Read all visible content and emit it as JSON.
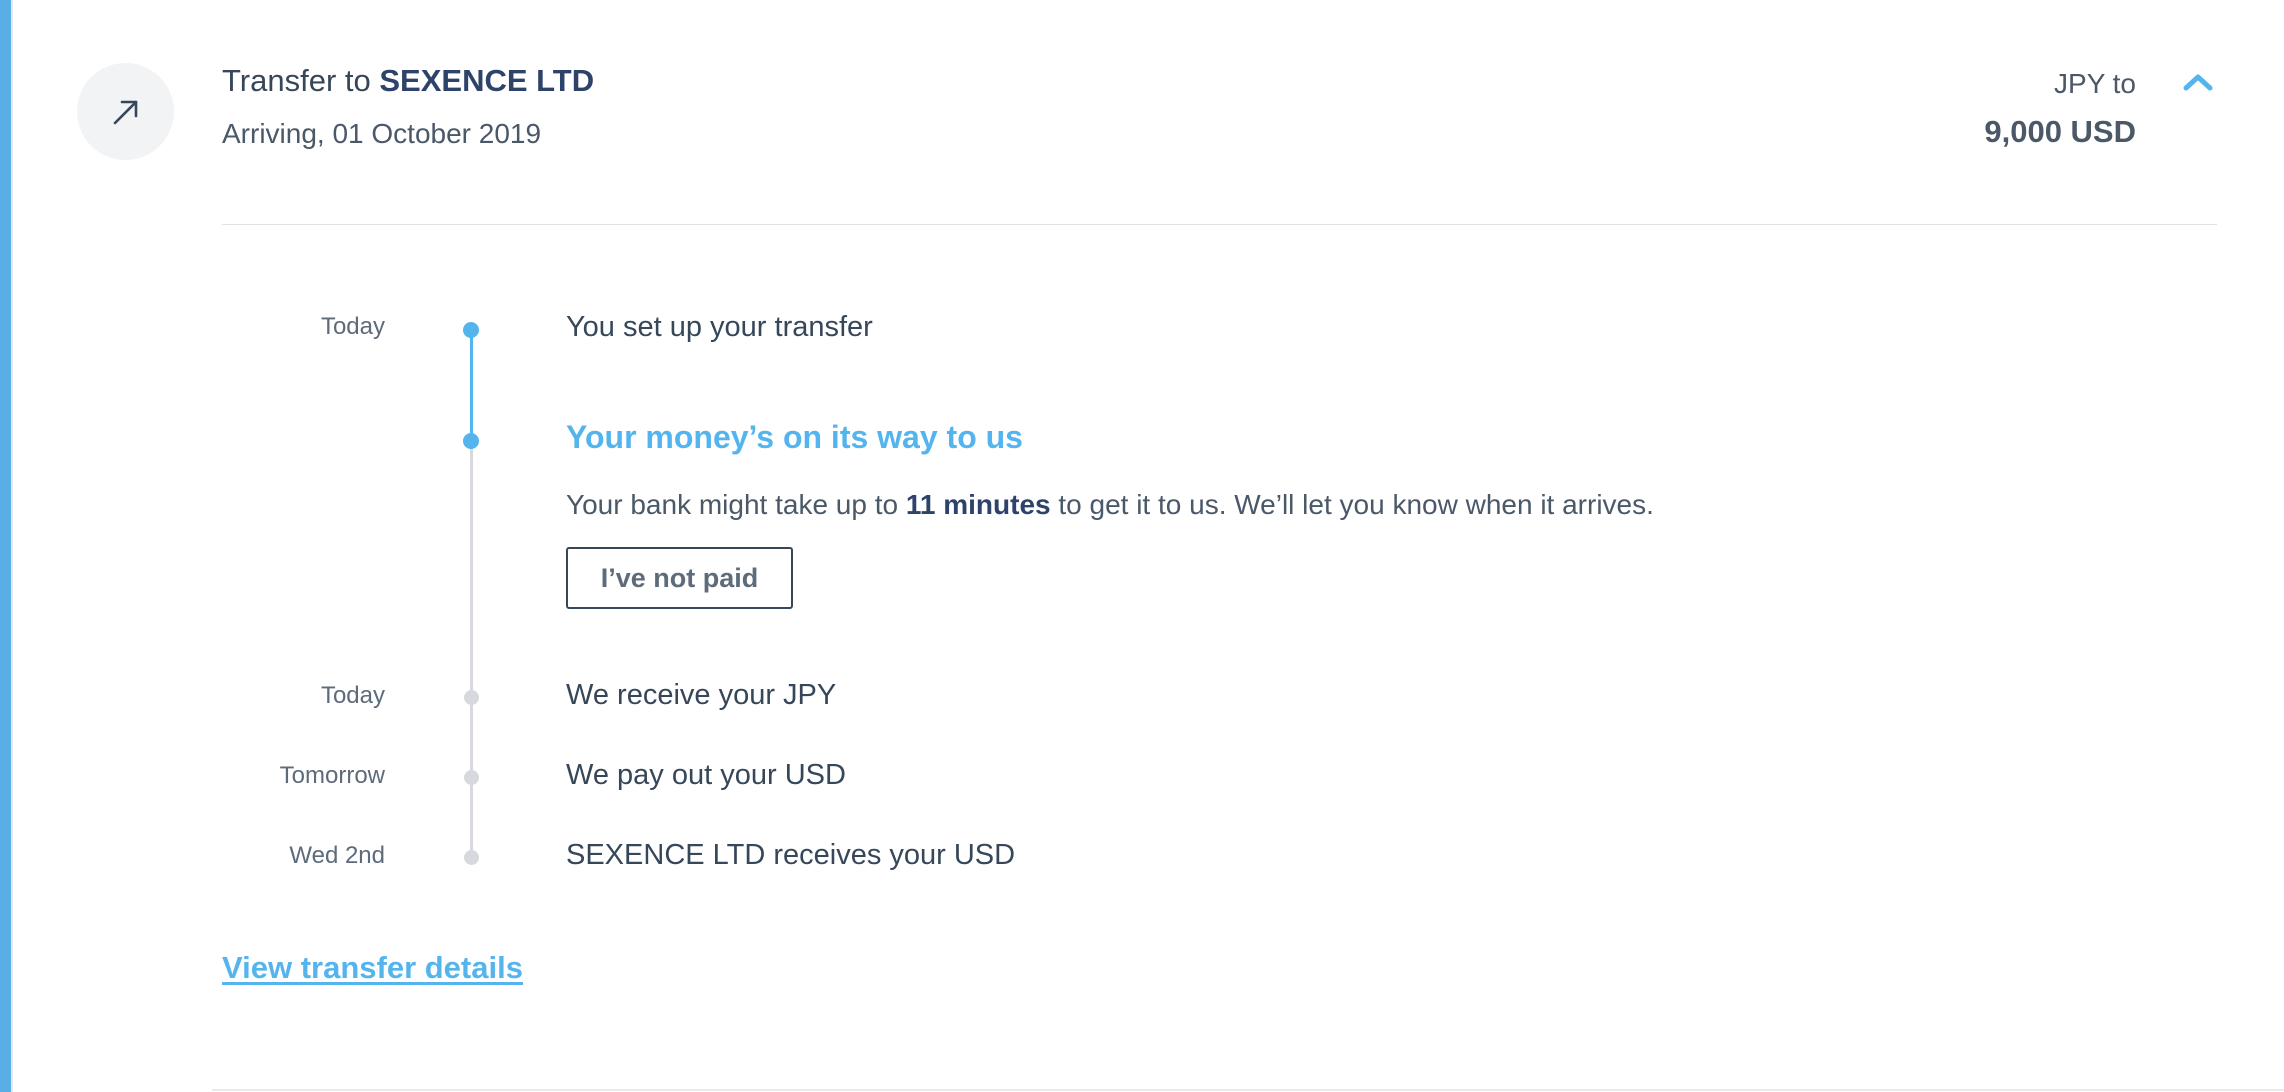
{
  "header": {
    "title_prefix": "Transfer to",
    "recipient": "SEXENCE LTD",
    "subtitle": "Arriving, 01 October 2019",
    "amount_from": "JPY to",
    "amount_to": "9,000 USD",
    "icon": "arrow-up-right-icon",
    "collapse_icon": "chevron-up-icon"
  },
  "timeline": {
    "step1": {
      "date": "Today",
      "text": "You set up your transfer"
    },
    "current": {
      "heading": "Your money’s on its way to us",
      "desc_before": "Your bank might take up to",
      "desc_highlight": "11 minutes",
      "desc_after": "to get it to us. We’ll let you know when it arrives.",
      "button_label": "I’ve not paid"
    },
    "step3": {
      "date": "Today",
      "text": "We receive your JPY"
    },
    "step4": {
      "date": "Tomorrow",
      "text": "We pay out your USD"
    },
    "step5": {
      "date": "Wed 2nd",
      "text": "SEXENCE LTD receives your USD"
    }
  },
  "footer": {
    "details_link": "View transfer details"
  },
  "colors": {
    "accent": "#54b4ee",
    "text_dark": "#2e4369",
    "text": "#37475a",
    "muted": "#d6d9dd"
  }
}
